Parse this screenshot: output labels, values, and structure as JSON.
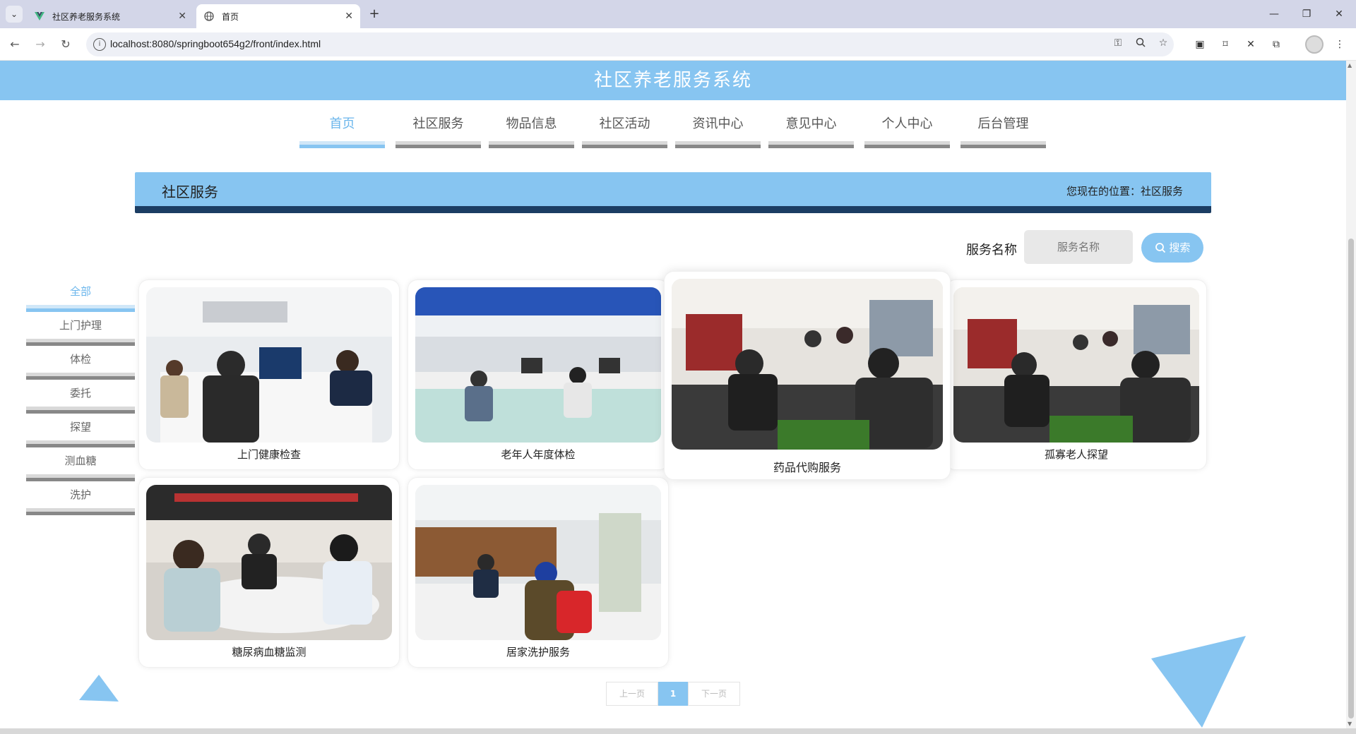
{
  "browser": {
    "tabs": [
      {
        "title": "社区养老服务系统"
      },
      {
        "title": "首页"
      }
    ],
    "url": "localhost:8080/springboot654g2/front/index.html"
  },
  "site": {
    "title": "社区养老服务系统"
  },
  "nav": {
    "items": [
      {
        "label": "首页"
      },
      {
        "label": "社区服务"
      },
      {
        "label": "物品信息"
      },
      {
        "label": "社区活动"
      },
      {
        "label": "资讯中心"
      },
      {
        "label": "意见中心"
      },
      {
        "label": "个人中心"
      },
      {
        "label": "后台管理"
      }
    ],
    "active_index": 0
  },
  "banner": {
    "title": "社区服务",
    "location": "您现在的位置：社区服务"
  },
  "search": {
    "label": "服务名称",
    "placeholder": "服务名称",
    "button_label": "搜索"
  },
  "categories": {
    "items": [
      {
        "label": "全部"
      },
      {
        "label": "上门护理"
      },
      {
        "label": "体检"
      },
      {
        "label": "委托"
      },
      {
        "label": "探望"
      },
      {
        "label": "测血糖"
      },
      {
        "label": "洗护"
      }
    ],
    "active_index": 0
  },
  "services": [
    {
      "name": "上门健康检查"
    },
    {
      "name": "老年人年度体检"
    },
    {
      "name": "药品代购服务"
    },
    {
      "name": "孤寡老人探望"
    },
    {
      "name": "糖尿病血糖监测"
    },
    {
      "name": "居家洗护服务"
    }
  ],
  "pagination": {
    "prev": "上一页",
    "current": "1",
    "next": "下一页"
  },
  "colors": {
    "accent": "#87c5f1",
    "banner_border": "#1b3d63"
  }
}
